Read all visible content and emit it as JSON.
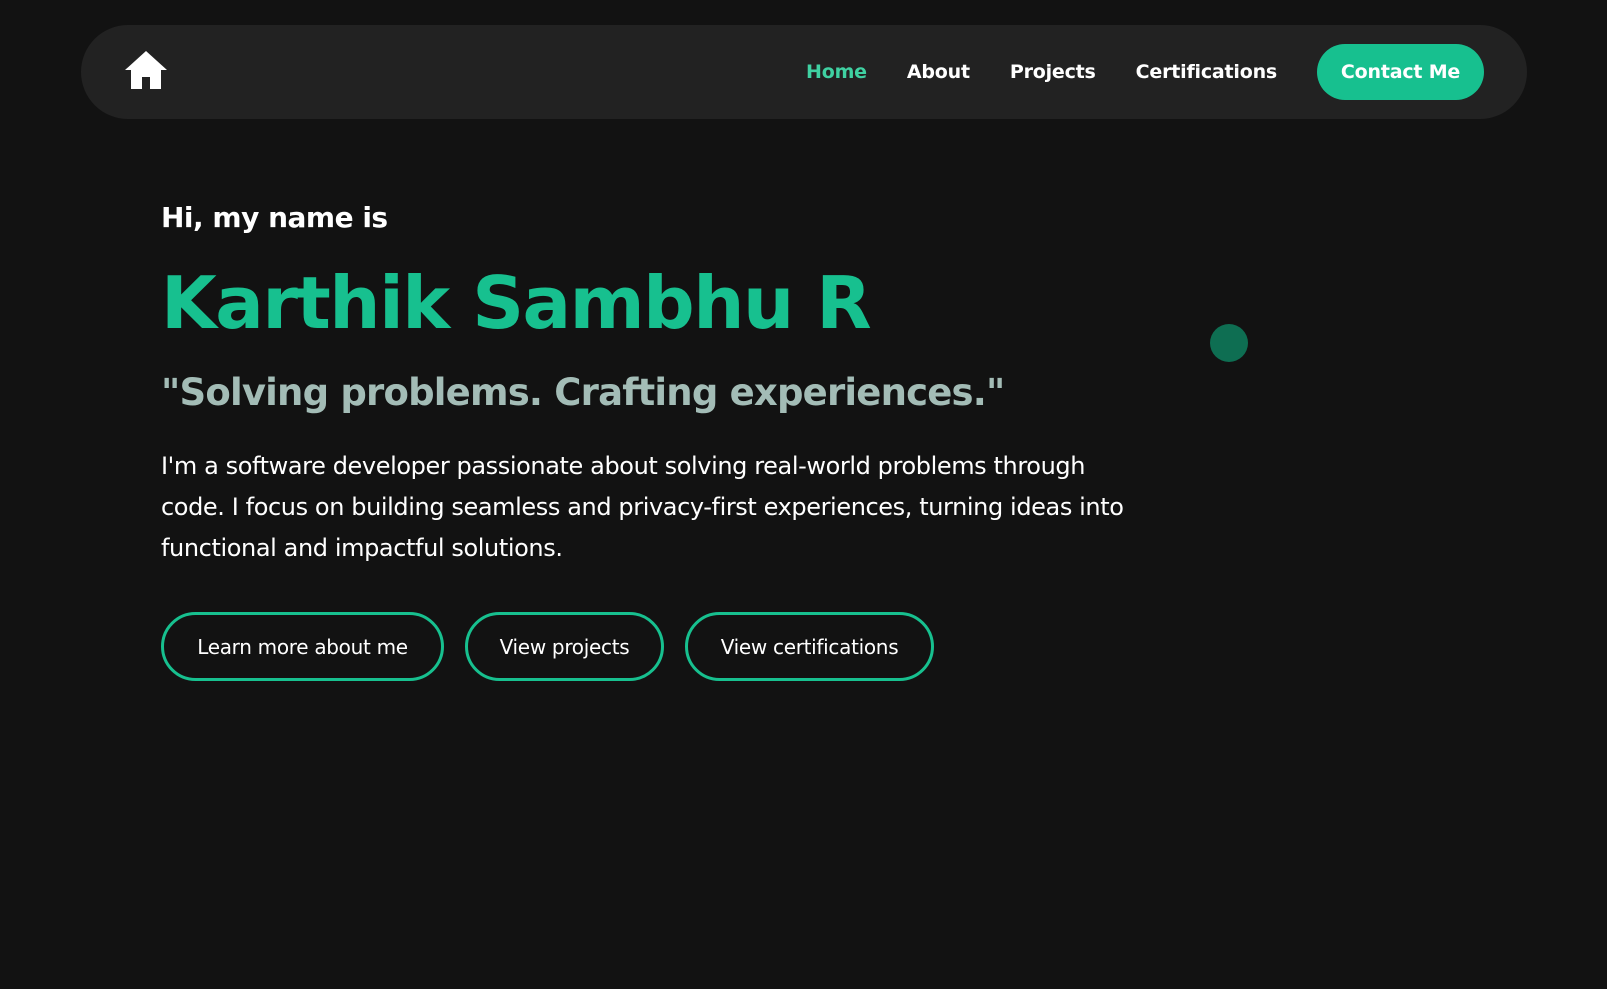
{
  "nav": {
    "home_icon": "home-icon",
    "links": [
      {
        "label": "Home",
        "active": true
      },
      {
        "label": "About",
        "active": false
      },
      {
        "label": "Projects",
        "active": false
      },
      {
        "label": "Certifications",
        "active": false
      }
    ],
    "contact_label": "Contact Me"
  },
  "hero": {
    "greeting": "Hi, my name is",
    "name": "Karthik Sambhu R",
    "tagline": "\"Solving problems. Crafting experiences.\"",
    "intro": "I'm a software developer passionate about solving real-world problems through code. I focus on building seamless and privacy-first experiences, turning ideas into functional and impactful solutions.",
    "buttons": {
      "about": "Learn more about me",
      "projects": "View projects",
      "certifications": "View certifications"
    }
  },
  "colors": {
    "background": "#121212",
    "navbar": "#222222",
    "accent": "#17c08f",
    "active_link": "#3fd1a2",
    "tagline": "#a3bcb6",
    "decor_dot": "#0e6e52"
  }
}
